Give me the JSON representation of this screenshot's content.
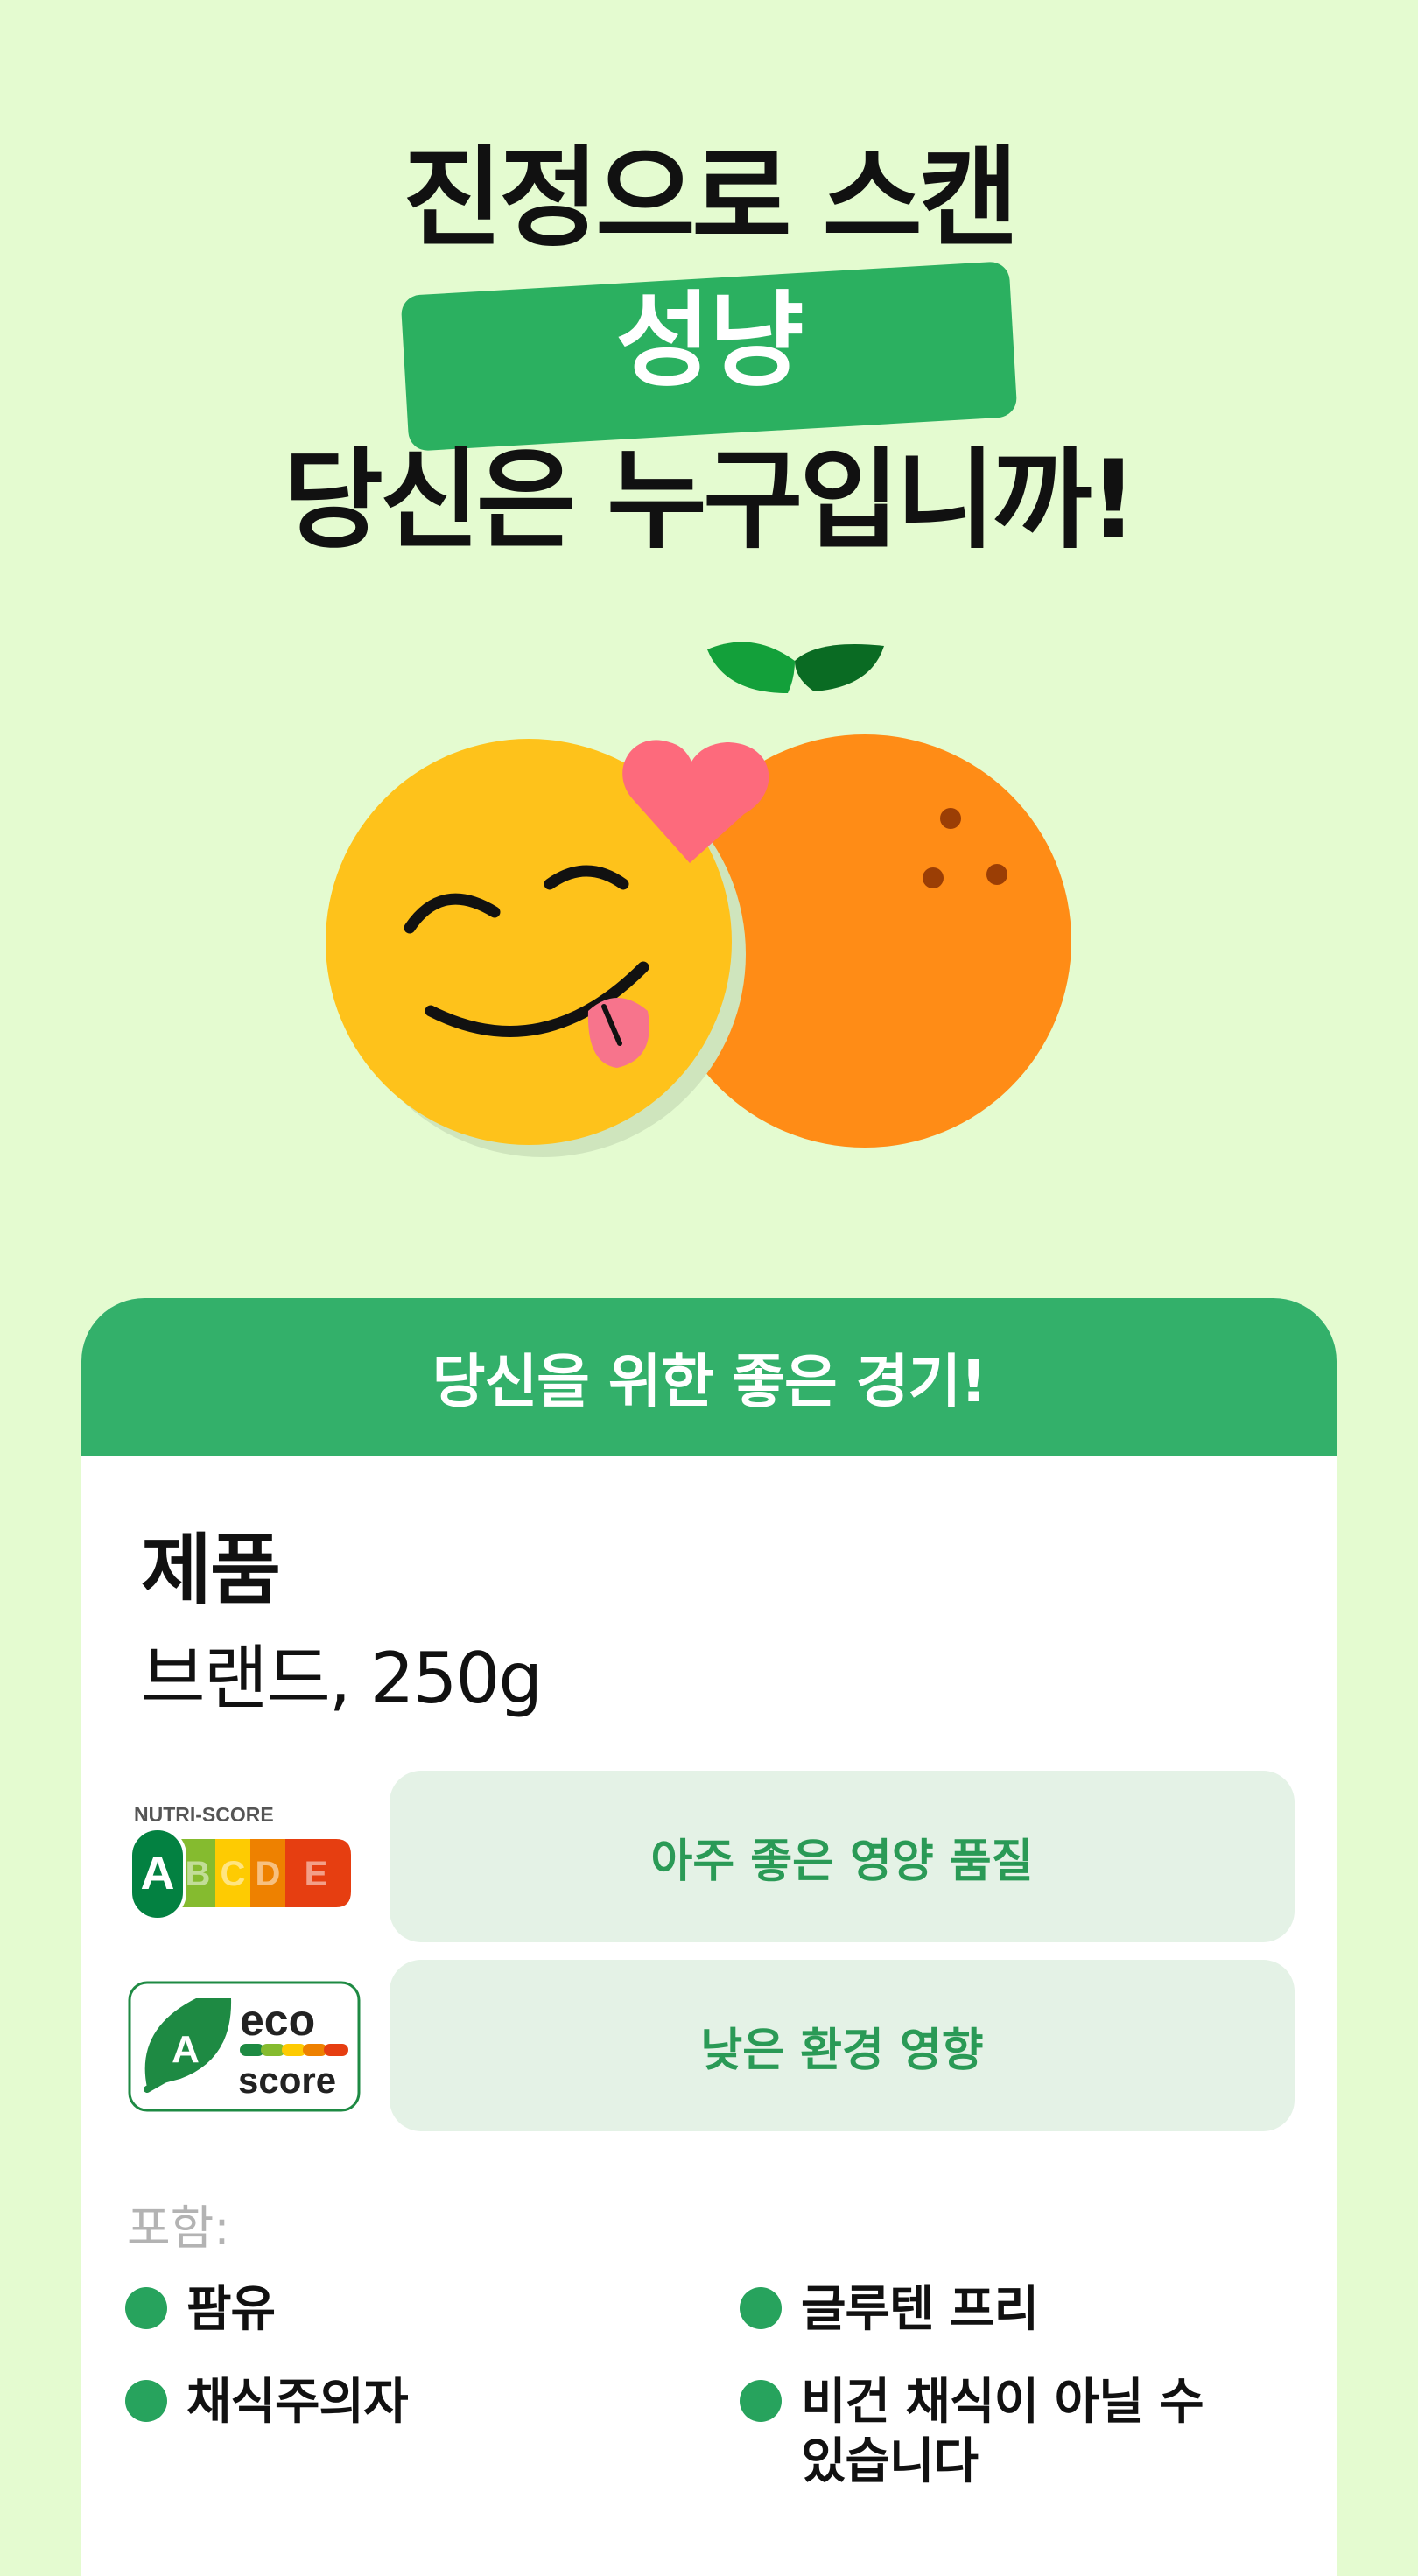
{
  "headline": {
    "line1": "진정으로 스캔",
    "highlight": "성냥",
    "line3": "당신은 누구입니까!"
  },
  "card": {
    "header": "당신을 위한 좋은 경기!",
    "product_name": "제품",
    "brand_and_size": "브랜드, 250g",
    "nutri_score": {
      "logo_title": "NUTRI-SCORE",
      "letters": [
        "A",
        "B",
        "C",
        "D",
        "E"
      ],
      "grade": "A",
      "colors": [
        "#038141",
        "#85bb2f",
        "#fecb02",
        "#ee8100",
        "#e63e11"
      ],
      "description": "아주 좋은 영양 품질"
    },
    "eco_score": {
      "logo_word1": "eco",
      "logo_word2": "score",
      "grade": "A",
      "description": "낮은 환경 영향"
    },
    "contains_label": "포함:",
    "tags": [
      "팜유",
      "글루텐 프리",
      "채식주의자",
      "비건 채식이 아닐 수 있습니다"
    ]
  },
  "illustration": {
    "left": "smiley-face-icon",
    "heart": "heart-icon",
    "right": "orange-fruit-icon"
  },
  "colors": {
    "background": "#e4fbd0",
    "brand_green": "#2bb060",
    "pill_background": "#e4f2e6",
    "tag_dot": "#27a35d"
  }
}
